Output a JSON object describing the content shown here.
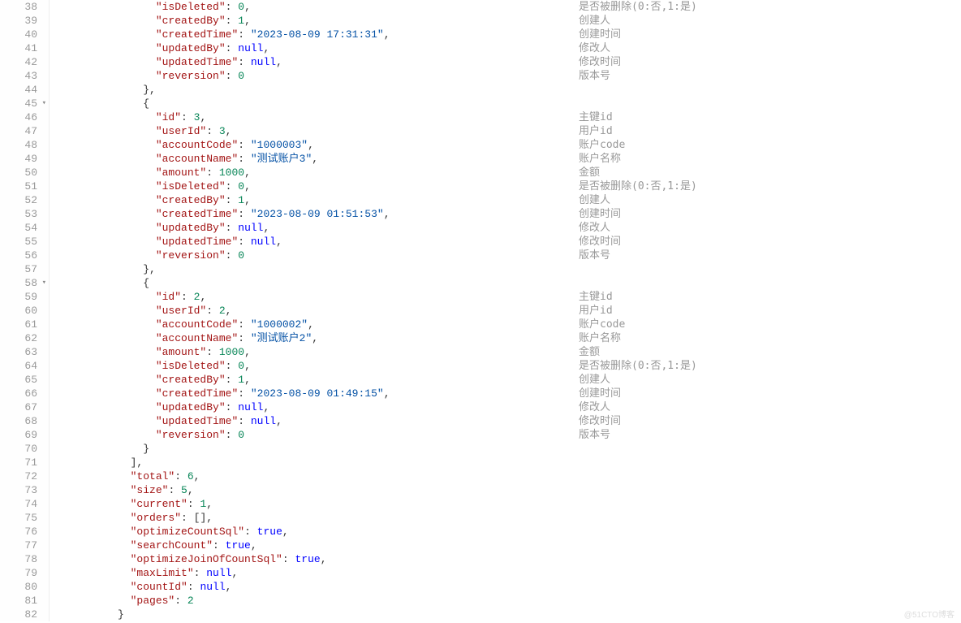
{
  "watermark": "@51CTO博客",
  "lines": [
    {
      "num": 38,
      "fold": false,
      "indent": 16,
      "key": "isDeleted",
      "colon": ": ",
      "val": "0",
      "vtype": "n",
      "comma": ",",
      "comment": "是否被删除(0:否,1:是)"
    },
    {
      "num": 39,
      "fold": false,
      "indent": 16,
      "key": "createdBy",
      "colon": ": ",
      "val": "1",
      "vtype": "n",
      "comma": ",",
      "comment": "创建人"
    },
    {
      "num": 40,
      "fold": false,
      "indent": 16,
      "key": "createdTime",
      "colon": ": ",
      "val": "\"2023-08-09 17:31:31\"",
      "vtype": "s",
      "comma": ",",
      "comment": "创建时间"
    },
    {
      "num": 41,
      "fold": false,
      "indent": 16,
      "key": "updatedBy",
      "colon": ": ",
      "val": "null",
      "vtype": "b",
      "comma": ",",
      "comment": "修改人"
    },
    {
      "num": 42,
      "fold": false,
      "indent": 16,
      "key": "updatedTime",
      "colon": ": ",
      "val": "null",
      "vtype": "b",
      "comma": ",",
      "comment": "修改时间"
    },
    {
      "num": 43,
      "fold": false,
      "indent": 16,
      "key": "reversion",
      "colon": ": ",
      "val": "0",
      "vtype": "n",
      "comma": "",
      "comment": "版本号"
    },
    {
      "num": 44,
      "fold": false,
      "indent": 14,
      "raw": "},",
      "comment": ""
    },
    {
      "num": 45,
      "fold": true,
      "indent": 14,
      "raw": "{",
      "comment": ""
    },
    {
      "num": 46,
      "fold": false,
      "indent": 16,
      "key": "id",
      "colon": ": ",
      "val": "3",
      "vtype": "n",
      "comma": ",",
      "comment": "主键id"
    },
    {
      "num": 47,
      "fold": false,
      "indent": 16,
      "key": "userId",
      "colon": ": ",
      "val": "3",
      "vtype": "n",
      "comma": ",",
      "comment": "用户id"
    },
    {
      "num": 48,
      "fold": false,
      "indent": 16,
      "key": "accountCode",
      "colon": ": ",
      "val": "\"1000003\"",
      "vtype": "s",
      "comma": ",",
      "comment": "账户code"
    },
    {
      "num": 49,
      "fold": false,
      "indent": 16,
      "key": "accountName",
      "colon": ": ",
      "val": "\"测试账户3\"",
      "vtype": "s",
      "comma": ",",
      "comment": "账户名称"
    },
    {
      "num": 50,
      "fold": false,
      "indent": 16,
      "key": "amount",
      "colon": ": ",
      "val": "1000",
      "vtype": "n",
      "comma": ",",
      "comment": "金额"
    },
    {
      "num": 51,
      "fold": false,
      "indent": 16,
      "key": "isDeleted",
      "colon": ": ",
      "val": "0",
      "vtype": "n",
      "comma": ",",
      "comment": "是否被删除(0:否,1:是)"
    },
    {
      "num": 52,
      "fold": false,
      "indent": 16,
      "key": "createdBy",
      "colon": ": ",
      "val": "1",
      "vtype": "n",
      "comma": ",",
      "comment": "创建人"
    },
    {
      "num": 53,
      "fold": false,
      "indent": 16,
      "key": "createdTime",
      "colon": ": ",
      "val": "\"2023-08-09 01:51:53\"",
      "vtype": "s",
      "comma": ",",
      "comment": "创建时间"
    },
    {
      "num": 54,
      "fold": false,
      "indent": 16,
      "key": "updatedBy",
      "colon": ": ",
      "val": "null",
      "vtype": "b",
      "comma": ",",
      "comment": "修改人"
    },
    {
      "num": 55,
      "fold": false,
      "indent": 16,
      "key": "updatedTime",
      "colon": ": ",
      "val": "null",
      "vtype": "b",
      "comma": ",",
      "comment": "修改时间"
    },
    {
      "num": 56,
      "fold": false,
      "indent": 16,
      "key": "reversion",
      "colon": ": ",
      "val": "0",
      "vtype": "n",
      "comma": "",
      "comment": "版本号"
    },
    {
      "num": 57,
      "fold": false,
      "indent": 14,
      "raw": "},",
      "comment": ""
    },
    {
      "num": 58,
      "fold": true,
      "indent": 14,
      "raw": "{",
      "comment": ""
    },
    {
      "num": 59,
      "fold": false,
      "indent": 16,
      "key": "id",
      "colon": ": ",
      "val": "2",
      "vtype": "n",
      "comma": ",",
      "comment": "主键id"
    },
    {
      "num": 60,
      "fold": false,
      "indent": 16,
      "key": "userId",
      "colon": ": ",
      "val": "2",
      "vtype": "n",
      "comma": ",",
      "comment": "用户id"
    },
    {
      "num": 61,
      "fold": false,
      "indent": 16,
      "key": "accountCode",
      "colon": ": ",
      "val": "\"1000002\"",
      "vtype": "s",
      "comma": ",",
      "comment": "账户code"
    },
    {
      "num": 62,
      "fold": false,
      "indent": 16,
      "key": "accountName",
      "colon": ": ",
      "val": "\"测试账户2\"",
      "vtype": "s",
      "comma": ",",
      "comment": "账户名称"
    },
    {
      "num": 63,
      "fold": false,
      "indent": 16,
      "key": "amount",
      "colon": ": ",
      "val": "1000",
      "vtype": "n",
      "comma": ",",
      "comment": "金额"
    },
    {
      "num": 64,
      "fold": false,
      "indent": 16,
      "key": "isDeleted",
      "colon": ": ",
      "val": "0",
      "vtype": "n",
      "comma": ",",
      "comment": "是否被删除(0:否,1:是)"
    },
    {
      "num": 65,
      "fold": false,
      "indent": 16,
      "key": "createdBy",
      "colon": ": ",
      "val": "1",
      "vtype": "n",
      "comma": ",",
      "comment": "创建人"
    },
    {
      "num": 66,
      "fold": false,
      "indent": 16,
      "key": "createdTime",
      "colon": ": ",
      "val": "\"2023-08-09 01:49:15\"",
      "vtype": "s",
      "comma": ",",
      "comment": "创建时间"
    },
    {
      "num": 67,
      "fold": false,
      "indent": 16,
      "key": "updatedBy",
      "colon": ": ",
      "val": "null",
      "vtype": "b",
      "comma": ",",
      "comment": "修改人"
    },
    {
      "num": 68,
      "fold": false,
      "indent": 16,
      "key": "updatedTime",
      "colon": ": ",
      "val": "null",
      "vtype": "b",
      "comma": ",",
      "comment": "修改时间"
    },
    {
      "num": 69,
      "fold": false,
      "indent": 16,
      "key": "reversion",
      "colon": ": ",
      "val": "0",
      "vtype": "n",
      "comma": "",
      "comment": "版本号"
    },
    {
      "num": 70,
      "fold": false,
      "indent": 14,
      "raw": "}",
      "comment": ""
    },
    {
      "num": 71,
      "fold": false,
      "indent": 12,
      "raw": "],",
      "comment": ""
    },
    {
      "num": 72,
      "fold": false,
      "indent": 12,
      "key": "total",
      "colon": ": ",
      "val": "6",
      "vtype": "n",
      "comma": ",",
      "comment": ""
    },
    {
      "num": 73,
      "fold": false,
      "indent": 12,
      "key": "size",
      "colon": ": ",
      "val": "5",
      "vtype": "n",
      "comma": ",",
      "comment": ""
    },
    {
      "num": 74,
      "fold": false,
      "indent": 12,
      "key": "current",
      "colon": ": ",
      "val": "1",
      "vtype": "n",
      "comma": ",",
      "comment": ""
    },
    {
      "num": 75,
      "fold": false,
      "indent": 12,
      "key": "orders",
      "colon": ": ",
      "val": "[]",
      "vtype": "p",
      "comma": ",",
      "comment": ""
    },
    {
      "num": 76,
      "fold": false,
      "indent": 12,
      "key": "optimizeCountSql",
      "colon": ": ",
      "val": "true",
      "vtype": "b",
      "comma": ",",
      "comment": ""
    },
    {
      "num": 77,
      "fold": false,
      "indent": 12,
      "key": "searchCount",
      "colon": ": ",
      "val": "true",
      "vtype": "b",
      "comma": ",",
      "comment": ""
    },
    {
      "num": 78,
      "fold": false,
      "indent": 12,
      "key": "optimizeJoinOfCountSql",
      "colon": ": ",
      "val": "true",
      "vtype": "b",
      "comma": ",",
      "comment": ""
    },
    {
      "num": 79,
      "fold": false,
      "indent": 12,
      "key": "maxLimit",
      "colon": ": ",
      "val": "null",
      "vtype": "b",
      "comma": ",",
      "comment": ""
    },
    {
      "num": 80,
      "fold": false,
      "indent": 12,
      "key": "countId",
      "colon": ": ",
      "val": "null",
      "vtype": "b",
      "comma": ",",
      "comment": ""
    },
    {
      "num": 81,
      "fold": false,
      "indent": 12,
      "key": "pages",
      "colon": ": ",
      "val": "2",
      "vtype": "n",
      "comma": "",
      "comment": ""
    },
    {
      "num": 82,
      "fold": false,
      "indent": 10,
      "raw": "}",
      "comment": ""
    }
  ]
}
